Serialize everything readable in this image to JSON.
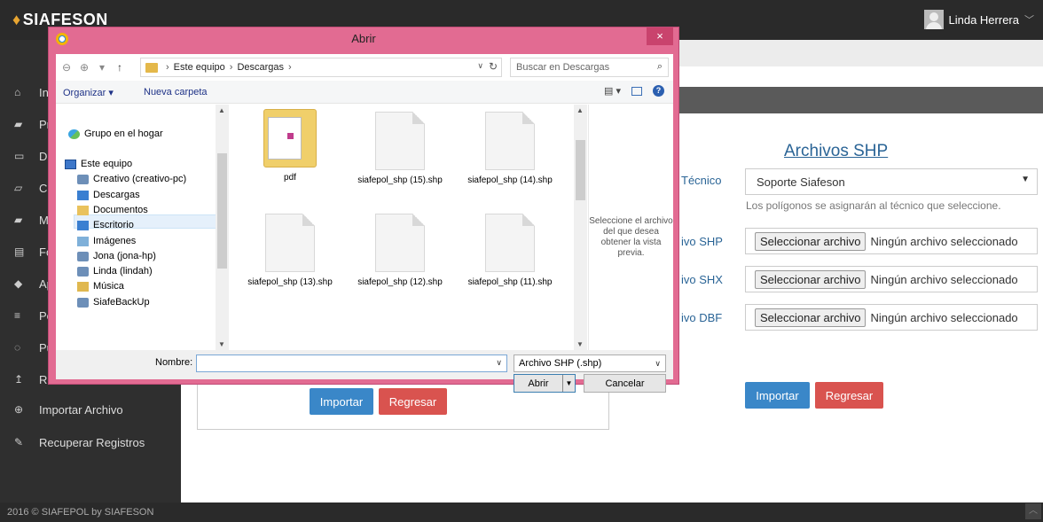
{
  "app": {
    "brand": "SIAFESON",
    "user_name": "Linda Herrera"
  },
  "sidebar": {
    "items": [
      {
        "label": "In",
        "icon": "home-icon",
        "glyph": "⌂"
      },
      {
        "label": "Pr",
        "icon": "book-icon",
        "glyph": "▰"
      },
      {
        "label": "D",
        "icon": "folder-icon",
        "glyph": "▭"
      },
      {
        "label": "Ci",
        "icon": "folder-open-icon",
        "glyph": "▱"
      },
      {
        "label": "M",
        "icon": "book-icon",
        "glyph": "▰"
      },
      {
        "label": "Fo",
        "icon": "file-icon",
        "glyph": "▤"
      },
      {
        "label": "Ap",
        "icon": "tint-icon",
        "glyph": "◆"
      },
      {
        "label": "Po",
        "icon": "list-icon",
        "glyph": "≡"
      },
      {
        "label": "Pu",
        "icon": "spinner-icon",
        "glyph": "◌"
      },
      {
        "label": "Re",
        "icon": "upload-icon",
        "glyph": "↥"
      },
      {
        "label": "Importar Archivo",
        "icon": "plus-circle-icon",
        "glyph": "⊕"
      },
      {
        "label": "Recuperar Registros",
        "icon": "wrench-icon",
        "glyph": "✎"
      }
    ]
  },
  "form": {
    "title": "Archivos SHP",
    "tecnico_label": "Técnico",
    "tecnico_value": "Soporte Siafeson",
    "tecnico_help": "Los polígonos se asignarán al técnico que seleccione.",
    "shp_label": "ivo SHP",
    "shx_label": "ivo SHX",
    "dbf_label": "ivo DBF",
    "choose_button": "Seleccionar archivo",
    "no_file": "Ningún archivo seleccionado",
    "import_button": "Importar",
    "back_button": "Regresar"
  },
  "footer": {
    "text": "2016 © SIAFEPOL by SIAFESON"
  },
  "dialog": {
    "title": "Abrir",
    "close": "×",
    "breadcrumb": [
      "Este equipo",
      "Descargas"
    ],
    "search_placeholder": "Buscar en Descargas",
    "organize": "Organizar ▾",
    "new_folder": "Nueva carpeta",
    "nav_items": [
      {
        "label": "Grupo en el hogar",
        "icon": "homegroup-icon"
      },
      {
        "label": "Este equipo",
        "icon": "computer-icon"
      },
      {
        "label": "Creativo (creativo-pc)",
        "icon": "network-computer-icon"
      },
      {
        "label": "Descargas",
        "icon": "downloads-folder-icon"
      },
      {
        "label": "Documentos",
        "icon": "documents-folder-icon"
      },
      {
        "label": "Escritorio",
        "icon": "desktop-folder-icon"
      },
      {
        "label": "Imágenes",
        "icon": "pictures-folder-icon"
      },
      {
        "label": "Jona (jona-hp)",
        "icon": "network-computer-icon"
      },
      {
        "label": "Linda (lindah)",
        "icon": "network-computer-icon"
      },
      {
        "label": "Música",
        "icon": "music-folder-icon"
      },
      {
        "label": "SiafeBackUp",
        "icon": "network-computer-icon"
      }
    ],
    "files": [
      {
        "name": "pdf",
        "kind": "folder"
      },
      {
        "name": "siafepol_shp (15).shp",
        "kind": "file"
      },
      {
        "name": "siafepol_shp (14).shp",
        "kind": "file"
      },
      {
        "name": "siafepol_shp (13).shp",
        "kind": "file"
      },
      {
        "name": "siafepol_shp (12).shp",
        "kind": "file"
      },
      {
        "name": "siafepol_shp (11).shp",
        "kind": "file"
      }
    ],
    "preview_text": "Seleccione el archivo del que desea obtener la vista previa.",
    "name_label": "Nombre:",
    "name_value": "",
    "filetype": "Archivo SHP (.shp)",
    "open_button": "Abrir",
    "cancel_button": "Cancelar"
  }
}
